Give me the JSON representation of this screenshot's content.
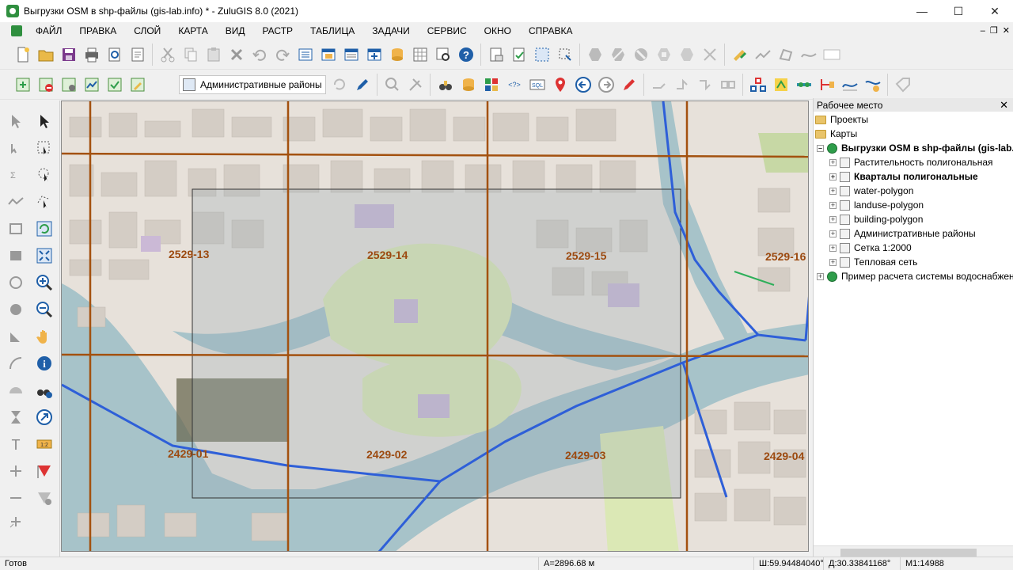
{
  "window": {
    "title": "Выгрузки OSM в shp-файлы (gis-lab.info) * - ZuluGIS 8.0 (2021)",
    "minimize": "—",
    "maximize": "☐",
    "close": "✕"
  },
  "menu": {
    "items": [
      "ФАЙЛ",
      "ПРАВКА",
      "СЛОЙ",
      "КАРТА",
      "ВИД",
      "РАСТР",
      "ТАБЛИЦА",
      "ЗАДАЧИ",
      "СЕРВИС",
      "ОКНО",
      "СПРАВКА"
    ],
    "mdi_minimize": "–",
    "mdi_restore": "❐",
    "mdi_close": "✕"
  },
  "layer_selector": {
    "value": "Административные районы"
  },
  "map": {
    "sheets": [
      "2529-13",
      "2529-14",
      "2529-15",
      "2529-16",
      "2429-01",
      "2429-02",
      "2429-03",
      "2429-04"
    ]
  },
  "panel": {
    "title": "Рабочее место",
    "close": "✕",
    "tree": [
      {
        "label": "Проекты",
        "kind": "folder"
      },
      {
        "label": "Карты",
        "kind": "folder"
      },
      {
        "label": "Выгрузки OSM в shp-файлы (gis-lab.info)",
        "kind": "map",
        "bold": true
      },
      {
        "label": "Растительность полигональная",
        "kind": "layer"
      },
      {
        "label": "Кварталы полигональные",
        "kind": "layer",
        "bold": true
      },
      {
        "label": "water-polygon",
        "kind": "layer"
      },
      {
        "label": "landuse-polygon",
        "kind": "layer"
      },
      {
        "label": "building-polygon",
        "kind": "layer"
      },
      {
        "label": "Административные районы",
        "kind": "layer"
      },
      {
        "label": "Сетка 1:2000",
        "kind": "layer"
      },
      {
        "label": "Тепловая сеть",
        "kind": "layer"
      },
      {
        "label": "Пример расчета системы водоснабжения",
        "kind": "map"
      }
    ]
  },
  "status": {
    "ready": "Готов",
    "area": "А=2896.68 м",
    "lat": "Ш:59.94484040°",
    "lon": "Д:30.33841168°",
    "scale": "М1:14988"
  },
  "colors": {
    "grid_line": "#a3510f",
    "district_line": "#2e5fd8",
    "water": "#a7c3c9",
    "park": "#dbe8b5",
    "sheet_label": "#9c4a10"
  }
}
